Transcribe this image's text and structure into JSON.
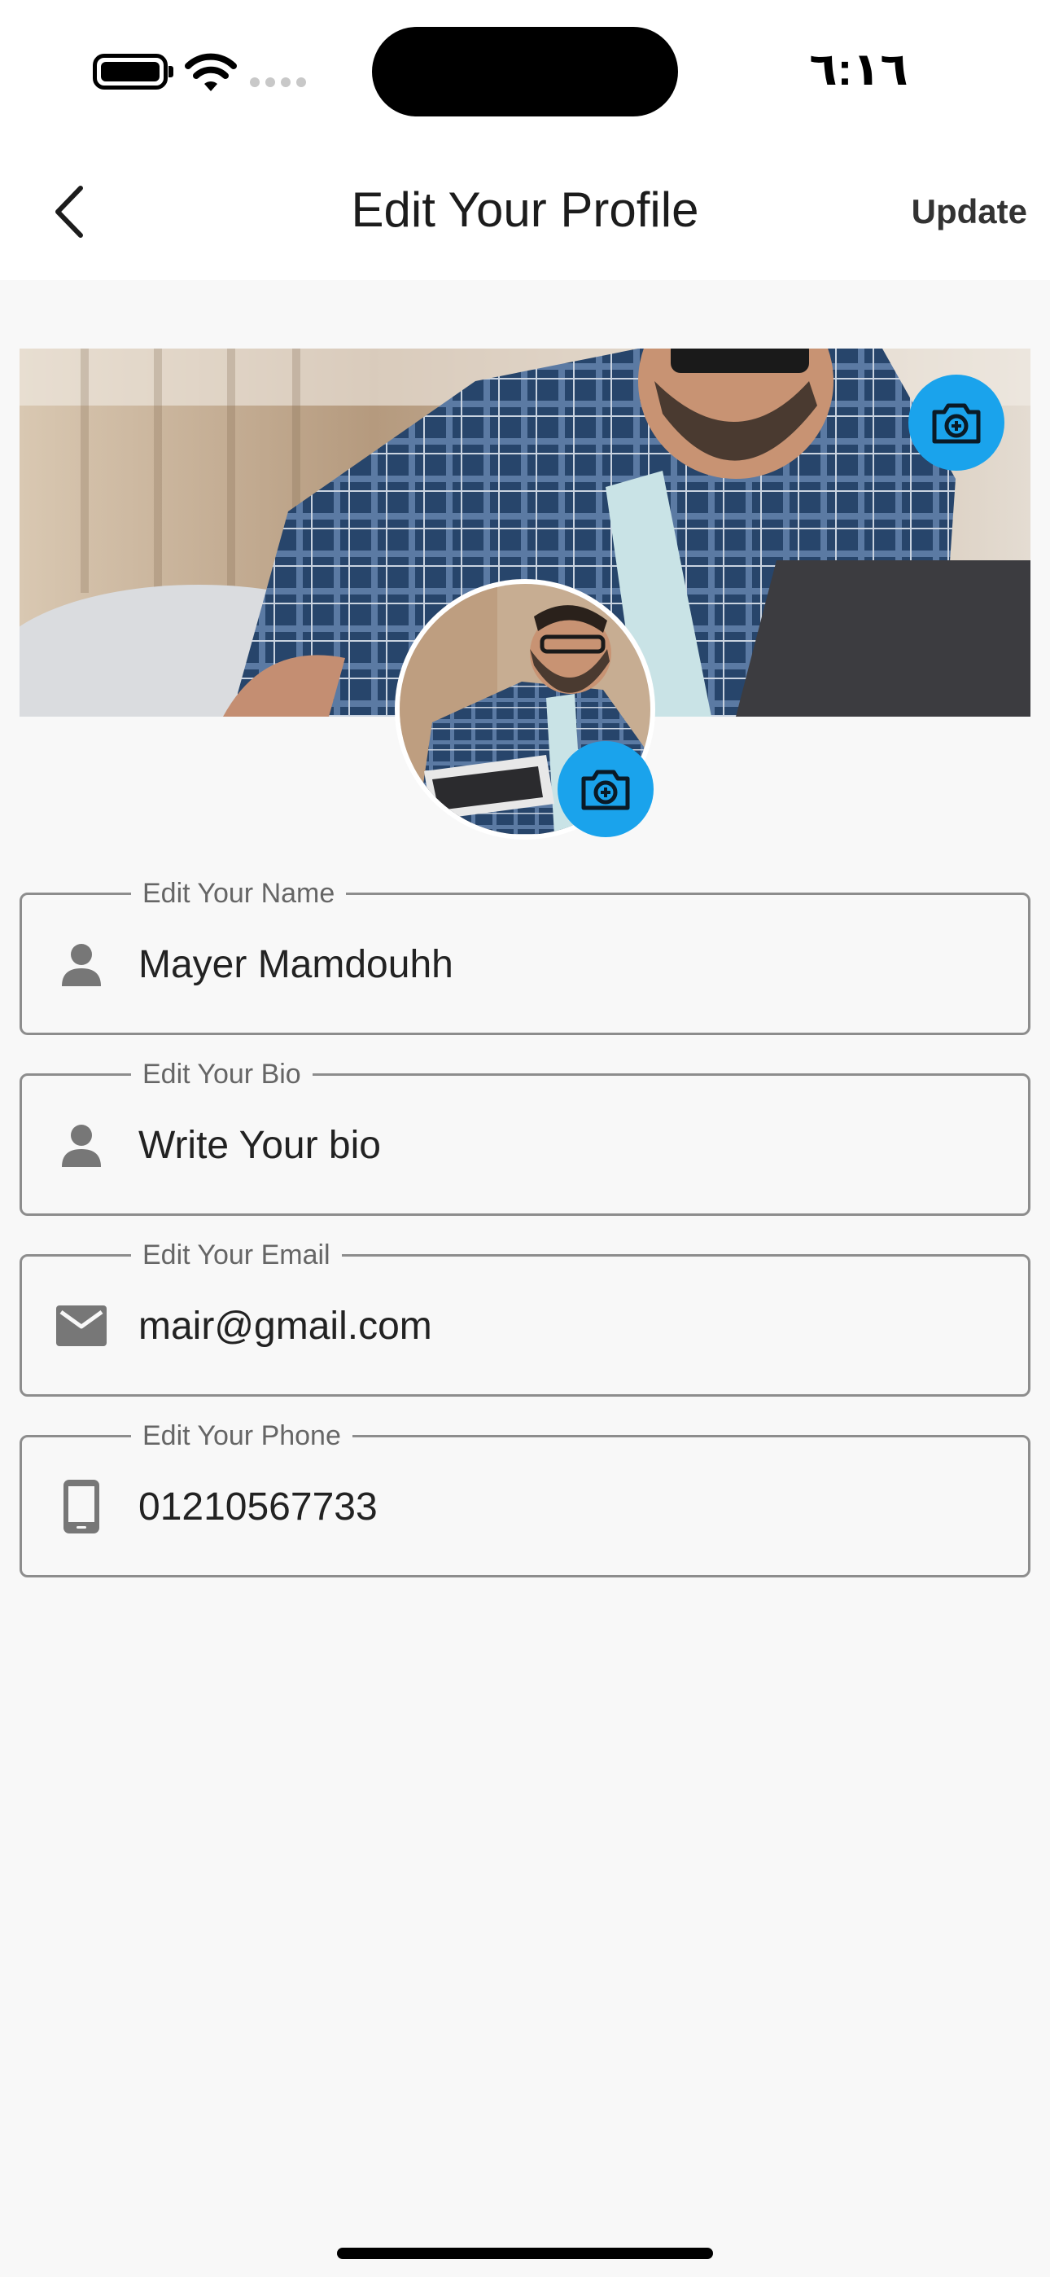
{
  "status_bar": {
    "time": "٦:١٦",
    "battery_icon": "battery-icon",
    "wifi_icon": "wifi-icon",
    "signal_icon": "signal-icon"
  },
  "app_bar": {
    "back_icon": "chevron-left-icon",
    "title": "Edit Your Profile",
    "action_label": "Update"
  },
  "profile": {
    "cover_image": "cover-photo",
    "avatar_image": "profile-photo",
    "camera_icon": "camera-add-icon",
    "accent_color": "#1aa3ec"
  },
  "fields": [
    {
      "label": "Edit Your Name",
      "value": "Mayer Mamdouhh",
      "icon": "person-icon"
    },
    {
      "label": "Edit Your Bio",
      "value": "Write Your bio",
      "icon": "person-icon"
    },
    {
      "label": "Edit Your Email",
      "value": "mair@gmail.com",
      "icon": "mail-icon"
    },
    {
      "label": "Edit Your Phone",
      "value": "01210567733",
      "icon": "phone-icon"
    }
  ]
}
